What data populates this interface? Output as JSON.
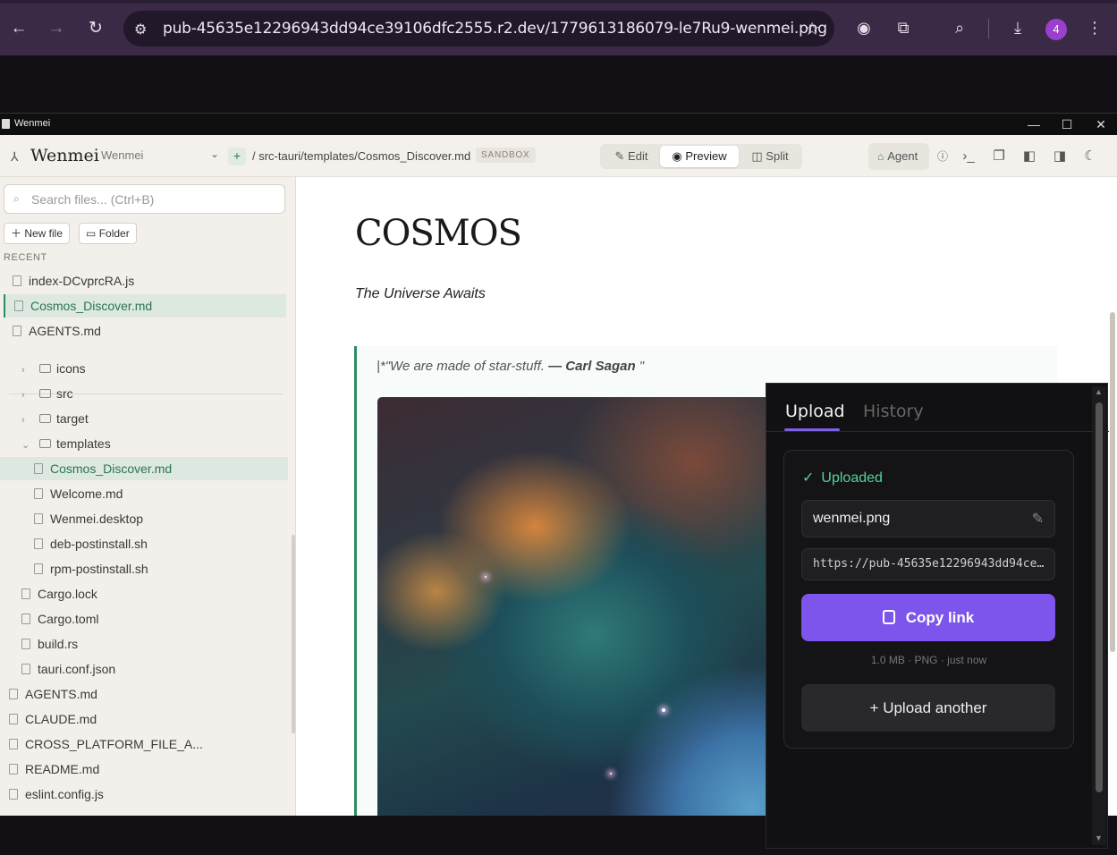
{
  "browser": {
    "url": "pub-45635e12296943dd94ce39106dfc2555.r2.dev/1779613186079-le7Ru9-wenmei.png",
    "profile_count": "4"
  },
  "window": {
    "title": "Wenmei",
    "controls": {
      "minimize": "—",
      "maximize": "☐",
      "close": "✕"
    }
  },
  "toolbar": {
    "logo": "Wenmei",
    "workspace": "Wenmei",
    "add": "+",
    "breadcrumb": "/  src-tauri/templates/Cosmos_Discover.md",
    "badge": "SANDBOX",
    "modes": [
      "Edit",
      "Preview",
      "Split"
    ],
    "active_mode": "Preview",
    "agent": "Agent"
  },
  "sidebar": {
    "search_placeholder": "Search files... (Ctrl+B)",
    "new_file": "New file",
    "folder": "Folder",
    "recent_label": "RECENT",
    "recent": [
      "index-DCvprcRA.js",
      "Cosmos_Discover.md",
      "AGENTS.md"
    ],
    "tree": [
      {
        "label": "icons",
        "kind": "folder",
        "depth": 1
      },
      {
        "label": "src",
        "kind": "folder",
        "depth": 1
      },
      {
        "label": "target",
        "kind": "folder",
        "depth": 1
      },
      {
        "label": "templates",
        "kind": "folder-open",
        "depth": 1
      },
      {
        "label": "Cosmos_Discover.md",
        "kind": "file",
        "depth": 2
      },
      {
        "label": "Welcome.md",
        "kind": "file",
        "depth": 2
      },
      {
        "label": "Wenmei.desktop",
        "kind": "file",
        "depth": 2
      },
      {
        "label": "deb-postinstall.sh",
        "kind": "file",
        "depth": 2
      },
      {
        "label": "rpm-postinstall.sh",
        "kind": "file",
        "depth": 2
      },
      {
        "label": "Cargo.lock",
        "kind": "file",
        "depth": 1
      },
      {
        "label": "Cargo.toml",
        "kind": "file",
        "depth": 1
      },
      {
        "label": "build.rs",
        "kind": "file",
        "depth": 1
      },
      {
        "label": "tauri.conf.json",
        "kind": "file",
        "depth": 1
      },
      {
        "label": "AGENTS.md",
        "kind": "file",
        "depth": 0
      },
      {
        "label": "CLAUDE.md",
        "kind": "file",
        "depth": 0
      },
      {
        "label": "CROSS_PLATFORM_FILE_A...",
        "kind": "file",
        "depth": 0
      },
      {
        "label": "README.md",
        "kind": "file",
        "depth": 0
      },
      {
        "label": "eslint.config.js",
        "kind": "file",
        "depth": 0
      }
    ]
  },
  "document": {
    "title": "COSMOS",
    "subtitle": "The Universe Awaits",
    "quote_prefix": "|*\"We are made of star-stuff. ",
    "quote_author": "— Carl Sagan",
    "quote_suffix": " \""
  },
  "upload_panel": {
    "tabs": [
      "Upload",
      "History"
    ],
    "active_tab": "Upload",
    "status": "Uploaded",
    "filename": "wenmei.png",
    "link": "https://pub-45635e12296943dd94ce39106dfc2555.r2.dev/1779613186079-le7Ru9-wenmei.png",
    "copy_label": "Copy link",
    "meta": "1.0 MB · PNG · just now",
    "upload_another": "+ Upload another",
    "accent_color": "#7d55ec",
    "status_color": "#55d39a"
  }
}
